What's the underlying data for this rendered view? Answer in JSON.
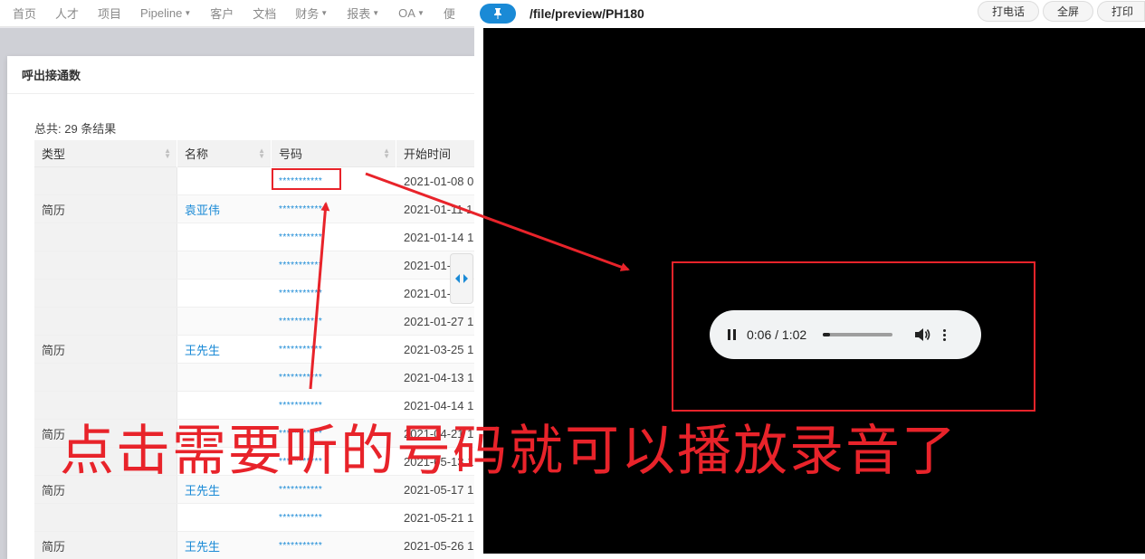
{
  "nav": {
    "items": [
      {
        "label": "首页",
        "caret": false
      },
      {
        "label": "人才",
        "caret": false
      },
      {
        "label": "项目",
        "caret": false
      },
      {
        "label": "Pipeline",
        "caret": true
      },
      {
        "label": "客户",
        "caret": false
      },
      {
        "label": "文档",
        "caret": false
      },
      {
        "label": "财务",
        "caret": true
      },
      {
        "label": "报表",
        "caret": true
      },
      {
        "label": "OA",
        "caret": true
      },
      {
        "label": "便",
        "caret": false
      }
    ]
  },
  "modal": {
    "title": "呼出接通数",
    "total": "总共: 29 条结果",
    "columns": [
      "类型",
      "名称",
      "号码",
      "开始时间"
    ],
    "rows": [
      {
        "type": "",
        "name": "",
        "phone": "***********",
        "start": "2021-01-08 0"
      },
      {
        "type": "简历",
        "name": "袁亚伟",
        "phone": "***********",
        "start": "2021-01-11 1"
      },
      {
        "type": "",
        "name": "",
        "phone": "***********",
        "start": "2021-01-14 1"
      },
      {
        "type": "",
        "name": "",
        "phone": "***********",
        "start": "2021-01-"
      },
      {
        "type": "",
        "name": "",
        "phone": "***********",
        "start": "2021-01-"
      },
      {
        "type": "",
        "name": "",
        "phone": "***********",
        "start": "2021-01-27 1"
      },
      {
        "type": "简历",
        "name": "王先生",
        "phone": "***********",
        "start": "2021-03-25 1"
      },
      {
        "type": "",
        "name": "",
        "phone": "***********",
        "start": "2021-04-13 1"
      },
      {
        "type": "",
        "name": "",
        "phone": "***********",
        "start": "2021-04-14 1"
      },
      {
        "type": "简历",
        "name": "",
        "phone": "***********",
        "start": "2021-04-21 1"
      },
      {
        "type": "",
        "name": "",
        "phone": "***********",
        "start": "2021-05-13 1"
      },
      {
        "type": "简历",
        "name": "王先生",
        "phone": "***********",
        "start": "2021-05-17 1"
      },
      {
        "type": "",
        "name": "",
        "phone": "***********",
        "start": "2021-05-21 1"
      },
      {
        "type": "简历",
        "name": "王先生",
        "phone": "***********",
        "start": "2021-05-26 1"
      }
    ]
  },
  "preview": {
    "path": "/file/preview/PH180",
    "pin_icon": "pin-icon",
    "actions": [
      "打电话",
      "全屏",
      "打印"
    ],
    "audio": {
      "time": "0:06 / 1:02",
      "progress": 0.1
    }
  },
  "annotation": {
    "caption": "点击需要听的号码就可以播放录音了",
    "color": "#e8232a"
  }
}
